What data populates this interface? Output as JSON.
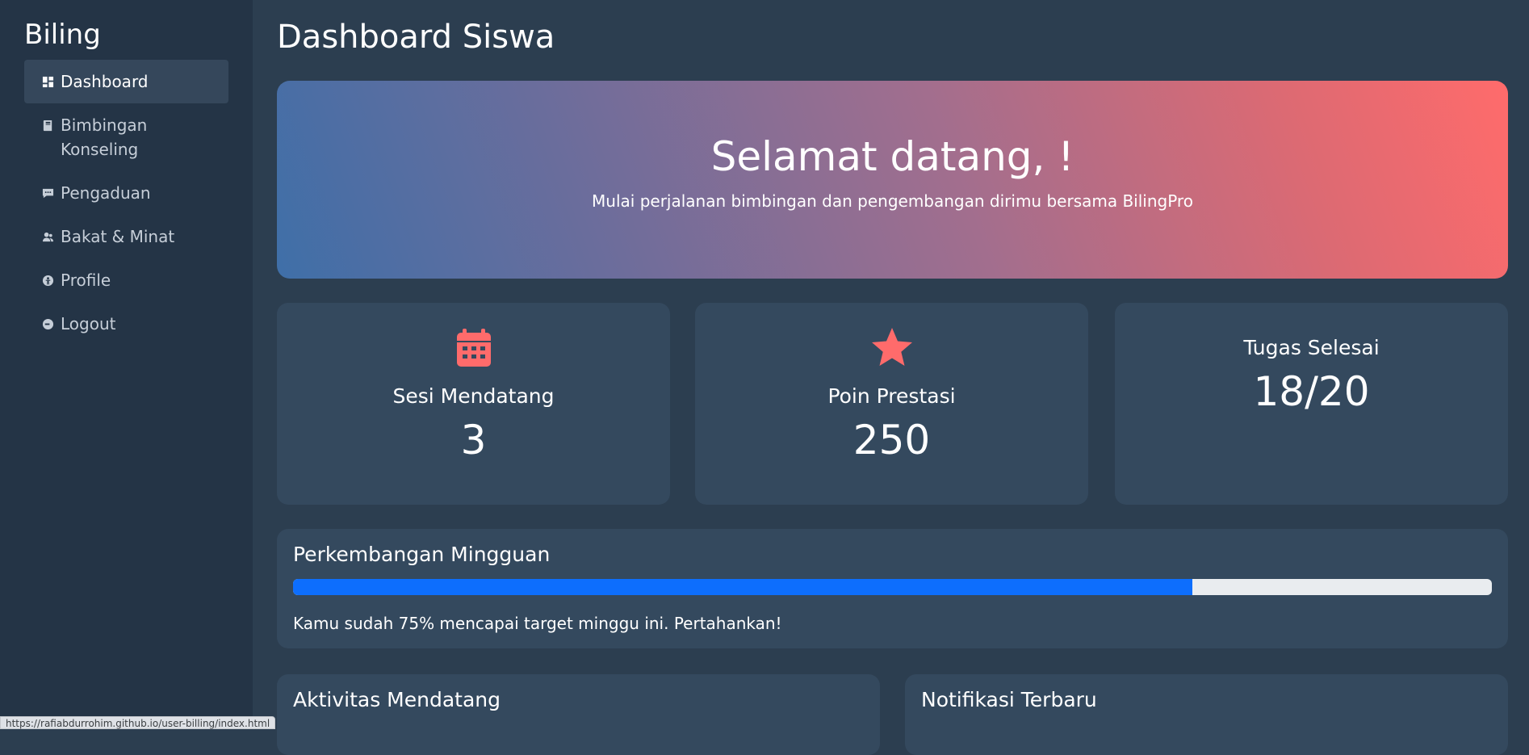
{
  "sidebar": {
    "brand": "Biling",
    "items": [
      {
        "label": "Dashboard",
        "icon": "dashboard-icon",
        "active": true
      },
      {
        "label": "Bimbingan Konseling",
        "icon": "book-icon"
      },
      {
        "label": "Pengaduan",
        "icon": "chat-icon"
      },
      {
        "label": "Bakat & Minat",
        "icon": "people-icon"
      },
      {
        "label": "Profile",
        "icon": "person-circle-icon"
      },
      {
        "label": "Logout",
        "icon": "logout-icon"
      }
    ]
  },
  "main": {
    "title": "Dashboard Siswa",
    "hero": {
      "title": "Selamat datang, !",
      "subtitle": "Mulai perjalanan bimbingan dan pengembangan dirimu bersama BilingPro"
    },
    "stats": [
      {
        "label": "Sesi Mendatang",
        "value": "3",
        "icon": "calendar-icon"
      },
      {
        "label": "Poin Prestasi",
        "value": "250",
        "icon": "star-icon"
      },
      {
        "label": "Tugas Selesai",
        "value": "18/20"
      }
    ],
    "progress": {
      "title": "Perkembangan Mingguan",
      "percent": 75,
      "message": "Kamu sudah 75% mencapai target minggu ini. Pertahankan!"
    },
    "bottom": {
      "activities_title": "Aktivitas Mendatang",
      "notifications_title": "Notifikasi Terbaru"
    }
  },
  "statusbar": {
    "url": "https://rafiabdurrohim.github.io/user-billing/index.html"
  },
  "colors": {
    "sidebar_bg": "#243446",
    "main_bg": "#2c3e50",
    "card_bg": "#34495e",
    "accent": "#ff6b6b",
    "progress": "#0d6efd"
  }
}
